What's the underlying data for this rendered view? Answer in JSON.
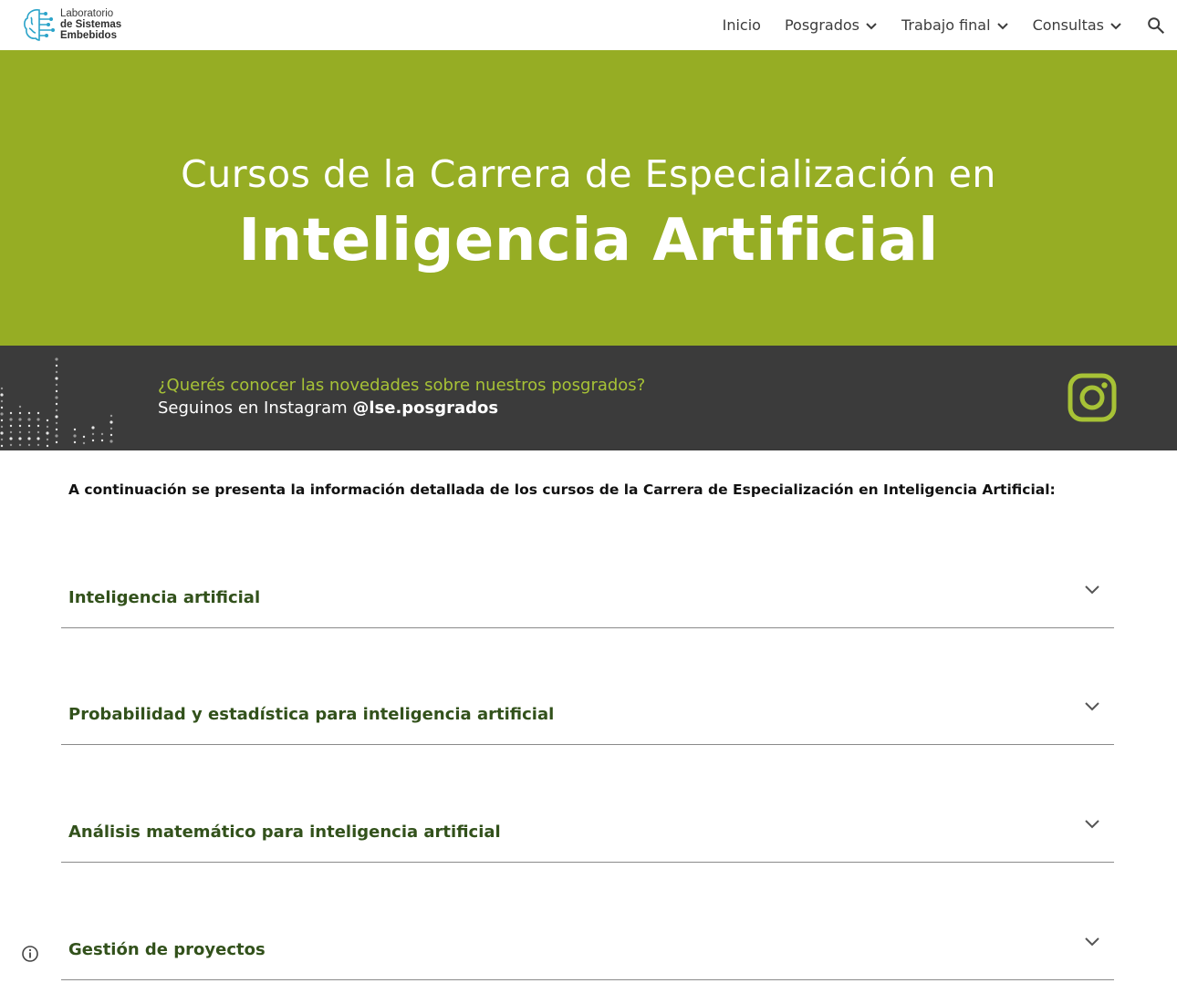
{
  "header": {
    "logo": {
      "line1": "Laboratorio",
      "line2": "de Sistemas",
      "line3": "Embebidos"
    },
    "nav": [
      {
        "label": "Inicio",
        "has_dropdown": false
      },
      {
        "label": "Posgrados",
        "has_dropdown": true
      },
      {
        "label": "Trabajo final",
        "has_dropdown": true
      },
      {
        "label": "Consultas",
        "has_dropdown": true
      }
    ],
    "search_icon": "search-icon"
  },
  "hero": {
    "subtitle": "Cursos de la Carrera de Especialización en",
    "title": "Inteligencia Artificial",
    "background": "#96ad24"
  },
  "banner": {
    "question": "¿Querés conocer las novedades sobre nuestros posgrados?",
    "follow_prefix": "Seguinos en Instagram ",
    "handle": "@lse.posgrados",
    "icon": "instagram-icon",
    "accent": "#a7c236",
    "background": "#3b3b3b"
  },
  "main": {
    "intro": "A continuación se presenta la información detallada de los cursos de la Carrera de Especialización en Inteligencia Artificial:",
    "accordions": [
      {
        "title": "Inteligencia artificial"
      },
      {
        "title": "Probabilidad y estadística para inteligencia artificial"
      },
      {
        "title": "Análisis matemático para inteligencia artificial"
      },
      {
        "title": "Gestión de proyectos"
      }
    ],
    "title_color": "#32511b"
  },
  "footer": {
    "info_icon": "info-icon"
  }
}
